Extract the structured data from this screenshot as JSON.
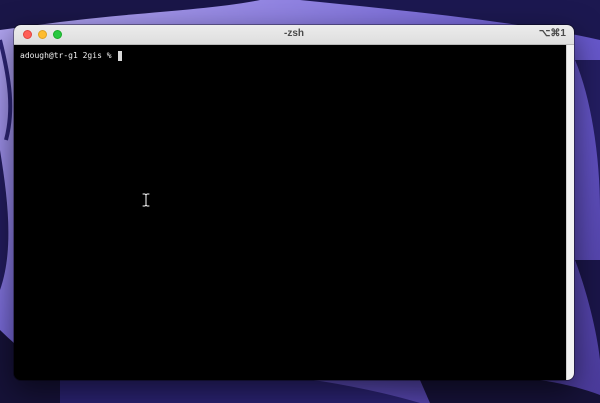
{
  "window": {
    "title": "-zsh",
    "shortcut": "⌥⌘1"
  },
  "terminal": {
    "prompt": "adough@tr-g1 2gis % "
  },
  "colors": {
    "close": "#ff5f57",
    "minimize": "#febc2e",
    "maximize": "#28c840",
    "terminal_bg": "#000000",
    "wallpaper": "#6c5fc4"
  },
  "icons": {
    "cursor": "i-beam-cursor-icon"
  }
}
